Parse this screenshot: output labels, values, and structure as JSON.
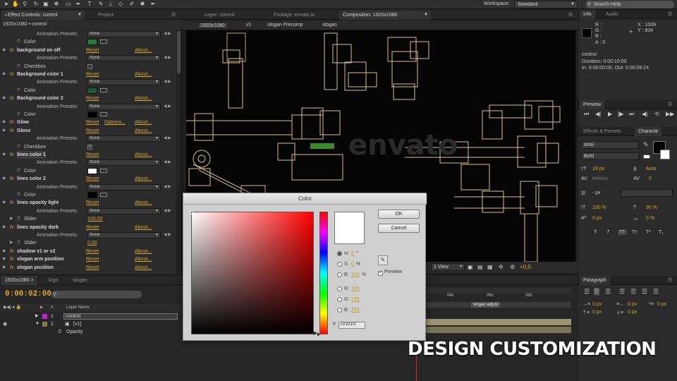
{
  "app": {
    "workspace_label": "Workspace:",
    "workspace_value": "Standard",
    "search_placeholder": "Search Help"
  },
  "left_panel": {
    "tabs": [
      "Effect Controls: control",
      "Project"
    ],
    "comp_line": "1920x1080 • control",
    "rows": [
      {
        "type": "sub",
        "label": "Animation Presets:",
        "value": "None"
      },
      {
        "type": "color",
        "label": "Color",
        "swatch": "#2a7a3a"
      },
      {
        "type": "effect",
        "label": "background on off",
        "reset": "Reset",
        "about": "About..."
      },
      {
        "type": "sub",
        "label": "Animation Presets:",
        "value": "None"
      },
      {
        "type": "check",
        "label": "Checkbox",
        "checked": false
      },
      {
        "type": "effect",
        "label": "Background color 1",
        "reset": "Reset",
        "about": "About..."
      },
      {
        "type": "sub",
        "label": "Animation Presets:",
        "value": "None"
      },
      {
        "type": "color",
        "label": "Color",
        "swatch": "#1f5a36"
      },
      {
        "type": "effect",
        "label": "Background color 2",
        "reset": "Reset",
        "about": "About..."
      },
      {
        "type": "sub",
        "label": "Animation Presets:",
        "value": "None"
      },
      {
        "type": "color",
        "label": "Color",
        "swatch": "#000000"
      },
      {
        "type": "effect",
        "label": "Glow",
        "reset": "Reset",
        "options": "Options...",
        "about": "About..."
      },
      {
        "type": "effect",
        "label": "Gloss",
        "reset": "Reset",
        "about": "About..."
      },
      {
        "type": "sub",
        "label": "Animation Presets:",
        "value": "None"
      },
      {
        "type": "check",
        "label": "Checkbox",
        "checked": true
      },
      {
        "type": "effect",
        "label": "lines color 1",
        "reset": "Reset",
        "about": "About...",
        "highlight": true
      },
      {
        "type": "sub",
        "label": "Animation Presets:",
        "value": "None"
      },
      {
        "type": "color",
        "label": "Color",
        "swatch": "#ffffff"
      },
      {
        "type": "effect",
        "label": "lines color 2",
        "reset": "Reset",
        "about": "About..."
      },
      {
        "type": "sub",
        "label": "Animation Presets:",
        "value": "None"
      },
      {
        "type": "color",
        "label": "Color",
        "swatch": "#000000"
      },
      {
        "type": "effect",
        "label": "lines opacity light",
        "reset": "Reset",
        "about": "About..."
      },
      {
        "type": "sub",
        "label": "Animation Presets:",
        "value": "None"
      },
      {
        "type": "slider",
        "label": "Slider",
        "value": "100,00"
      },
      {
        "type": "effect",
        "label": "lines opacity dark",
        "reset": "Reset",
        "about": "About..."
      },
      {
        "type": "sub",
        "label": "Animation Presets:",
        "value": "None"
      },
      {
        "type": "slider",
        "label": "Slider",
        "value": "0,00"
      },
      {
        "type": "effect",
        "label": "shadow v1 or v2",
        "reset": "Reset",
        "about": "About..."
      },
      {
        "type": "effect",
        "label": "slogan arm position",
        "reset": "Reset",
        "about": "About..."
      },
      {
        "type": "effect",
        "label": "slogan position",
        "reset": "Reset",
        "about": "About..."
      }
    ]
  },
  "viewer": {
    "tabs": [
      "Layer: control",
      "Footage: envato.ai",
      "Composition: 1920x1080"
    ],
    "crumbs": [
      "1920x1080",
      "v1",
      "slogan Precomp",
      "slogan"
    ],
    "watermark": "envato",
    "view_select": "1 View",
    "exposure": "+0,0"
  },
  "info": {
    "tabs": [
      "Info",
      "Audio"
    ],
    "r": "R :",
    "g": "G :",
    "b": "B :",
    "a": "A : 0",
    "x": "X : 1006",
    "y": "Y : 834",
    "layer": "control",
    "duration": "Duration: 0:00:10:00",
    "inout": "In: 0:00:00:00, Out: 0:00:09:24"
  },
  "preview": {
    "tab": "Preview"
  },
  "character": {
    "tabs": [
      "Effects & Presets",
      "Characte"
    ],
    "font": "Arial",
    "style": "Bold",
    "size": "19 px",
    "leading": "Auto",
    "kerning": "Metrics",
    "tracking": "0",
    "stroke": "- px",
    "vscale": "100 %",
    "hscale": "90 %",
    "baseline": "0 px",
    "tsume": "0 %",
    "style_buttons": [
      "T",
      "T",
      "TT",
      "Tт",
      "T¹",
      "T₁"
    ]
  },
  "paragraph": {
    "tab": "Paragraph",
    "indent_left": "0 px",
    "indent_right": "0 px",
    "indent_first": "0 px",
    "space_before": "0 px",
    "space_after": "0 px"
  },
  "timeline": {
    "tabs": [
      "1920x1080",
      "logo",
      "slogan"
    ],
    "timecode": "0:00:02:00",
    "header_layer": "Layer Name",
    "layers": [
      {
        "num": "1",
        "name": "control",
        "color": "#c21fd6"
      },
      {
        "num": "2",
        "name": "[v1]",
        "color": "#8b7a45"
      }
    ],
    "prop": "Opacity",
    "ruler": [
      "04s",
      "06s",
      "08s"
    ],
    "marker": "slogan adjust"
  },
  "color_dialog": {
    "title": "Color",
    "ok": "OK",
    "cancel": "Cancel",
    "h_label": "H:",
    "h_value": "0",
    "h_unit": "°",
    "s_label": "S:",
    "s_value": "0",
    "s_unit": "%",
    "b_label": "B:",
    "b_value": "100",
    "b_unit": "%",
    "r_label": "R:",
    "r_value": "255",
    "g_label": "G:",
    "g_value": "255",
    "bl_label": "B:",
    "bl_value": "255",
    "hex": "FFFFFF",
    "preview_label": "Preview",
    "preview_color": "#ffffff"
  },
  "caption": "DESIGN CUSTOMIZATION"
}
